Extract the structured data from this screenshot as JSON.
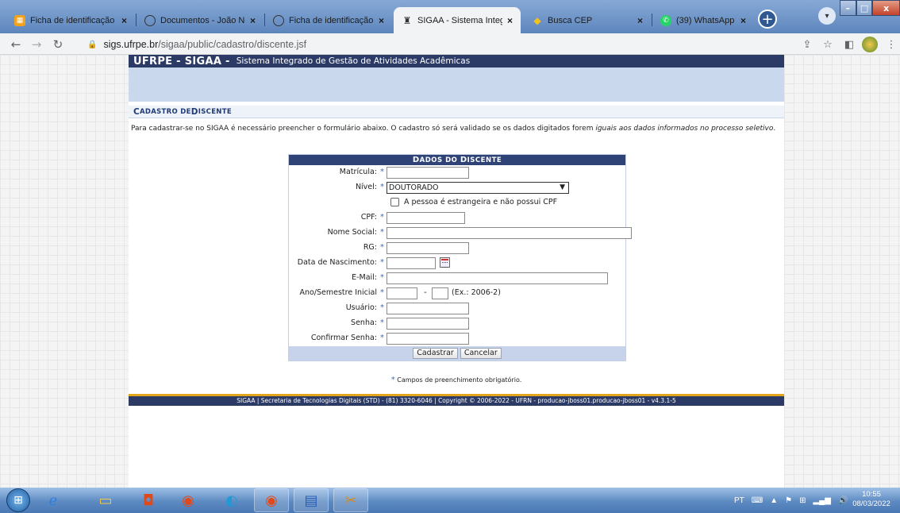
{
  "browser": {
    "tabs": [
      {
        "title": "Ficha de identificação d",
        "icon": "uf-icon",
        "active": false
      },
      {
        "title": "Documentos - João Ne",
        "icon": "globe-icon",
        "active": false
      },
      {
        "title": "Ficha de identificação d",
        "icon": "globe-icon",
        "active": false
      },
      {
        "title": "SIGAA - Sistema Integra",
        "icon": "sigaa-icon",
        "active": true
      },
      {
        "title": "Busca CEP",
        "icon": "correios-icon",
        "active": false
      },
      {
        "title": "(39) WhatsApp",
        "icon": "whatsapp-icon",
        "active": false
      }
    ],
    "tab_close_glyph": "×",
    "new_tab_glyph": "+",
    "url_host": "sigs.ufrpe.br",
    "url_path": "/sigaa/public/cadastro/discente.jsf",
    "win_min": "–",
    "win_max": "□",
    "win_close": "x"
  },
  "header": {
    "brand": "UFRPE - SIGAA -",
    "subtitle": "Sistema Integrado de Gestão de Atividades Acadêmicas"
  },
  "section": {
    "title_c": "C",
    "title_rest": "ADASTRO DE ",
    "title_d": "D",
    "title_rest2": "ISCENTE"
  },
  "intro": {
    "text_before": "Para cadastrar-se no SIGAA é necessário preencher o formulário abaixo. O cadastro só será validado se os dados digitados forem ",
    "text_em": "iguais aos dados informados no processo seletivo",
    "text_after": "."
  },
  "form": {
    "head_d": "D",
    "head_rest": "ADOS DO ",
    "head_d2": "D",
    "head_rest2": "ISCENTE",
    "required_star": "*",
    "labels": {
      "matricula": "Matrícula:",
      "nivel": "Nível:",
      "cpf": "CPF:",
      "nome_social": "Nome Social:",
      "rg": "RG:",
      "data_nascimento": "Data de Nascimento:",
      "email": "E-Mail:",
      "ano_semestre": "Ano/Semestre Inicial",
      "usuario": "Usuário:",
      "senha": "Senha:",
      "confirmar_senha": "Confirmar Senha:"
    },
    "nivel_selected": "DOUTORADO",
    "estrangeira_label": "A pessoa é estrangeira e não possui CPF",
    "estrangeira_checked": false,
    "ano_sep": "-",
    "ano_example": "(Ex.: 2006-2)",
    "values": {
      "matricula": "",
      "cpf": "",
      "nome_social": "",
      "rg": "",
      "data_nascimento": "",
      "email": "",
      "ano": "",
      "semestre": "",
      "usuario": "",
      "senha": "",
      "confirmar_senha": ""
    },
    "submit_label": "Cadastrar",
    "cancel_label": "Cancelar"
  },
  "legend": {
    "star": "*",
    "text": "Campos de preenchimento obrigatório."
  },
  "footer": {
    "text": "SIGAA | Secretaria de Tecnologias Digitais (STD) - (81) 3320-6046 | Copyright © 2006-2022 - UFRN - producao-jboss01.producao-jboss01 - v4.3.1-5"
  },
  "taskbar": {
    "language": "PT",
    "time": "10:55",
    "date": "08/03/2022"
  },
  "colors": {
    "header_navy": "#2c3a66",
    "banner_blue": "#cad8ee",
    "footer_gold": "#e3a51b",
    "required_blue": "#3c6bc4"
  }
}
